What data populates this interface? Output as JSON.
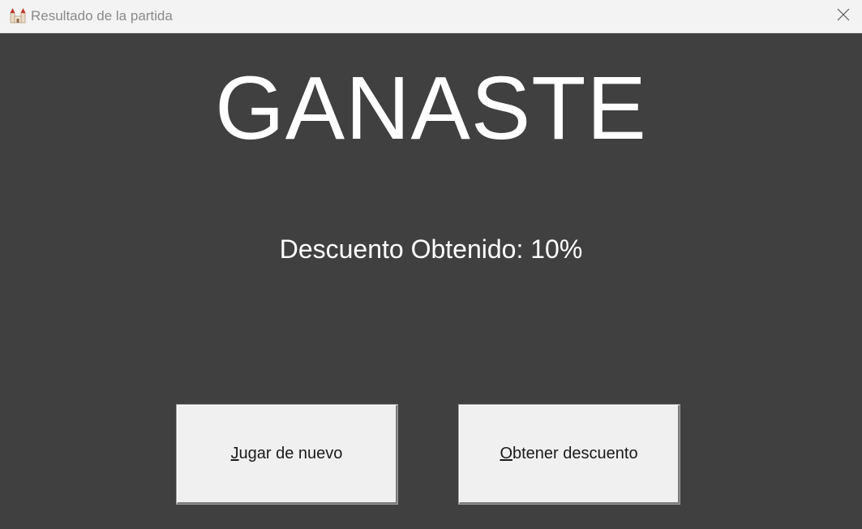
{
  "window": {
    "title": "Resultado de la partida",
    "app_icon": "castle-icon",
    "close_icon": "close-icon"
  },
  "result": {
    "headline": "GANASTE",
    "discount_text": "Descuento Obtenido: 10%"
  },
  "buttons": {
    "play_again": {
      "mnemonic": "J",
      "rest": "ugar de nuevo"
    },
    "get_discount": {
      "mnemonic": "O",
      "rest": "btener descuento"
    }
  },
  "colors": {
    "background": "#404040",
    "titlebar": "#f3f3f3",
    "text": "#ffffff",
    "button_face": "#f0f0f0"
  }
}
